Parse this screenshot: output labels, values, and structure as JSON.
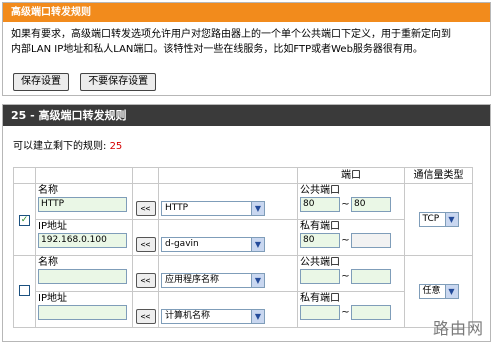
{
  "advanced_forwarding": {
    "title": "高级端口转发规则",
    "description_line1": "如果有要求，高级端口转发选项允许用户对您路由器上的一个单个公共端口下定义，用于重新定向到",
    "description_line2": "内部LAN IP地址和私人LAN端口。该特性对一些在线服务，比如FTP或者Web服务器很有用。",
    "save_label": "保存设置",
    "dont_save_label": "不要保存设置"
  },
  "rules_section": {
    "title": "25 - 高级端口转发规则",
    "remaining_label": "可以建立剩下的规则: ",
    "remaining_count": "25",
    "header_port": "端口",
    "header_traffic_type": "通信量类型"
  },
  "rules": [
    {
      "checked": true,
      "check_mark": "✓",
      "name_label": "名称",
      "name_value": "HTTP",
      "arrow_label": "<<",
      "app_select": "HTTP",
      "ip_label": "IP地址",
      "ip_value": "192.168.0.100",
      "computer_select": "d-gavin",
      "public_port_label": "公共端口",
      "public_port_start": "80",
      "public_port_end": "80",
      "tilde": "~",
      "private_port_label": "私有端口",
      "private_port_start": "80",
      "private_port_end": "",
      "traffic_type": "TCP"
    },
    {
      "checked": false,
      "check_mark": "",
      "name_label": "名称",
      "name_value": "",
      "arrow_label": "<<",
      "app_select": "应用程序名称",
      "ip_label": "IP地址",
      "ip_value": "",
      "computer_select": "计算机名称",
      "public_port_label": "公共端口",
      "public_port_start": "",
      "public_port_end": "",
      "tilde": "~",
      "private_port_label": "私有端口",
      "private_port_start": "",
      "private_port_end": "",
      "traffic_type": "任意"
    }
  ],
  "watermark": "路由网",
  "icons": {
    "select_arrow": "chevron-down-icon",
    "checkbox": "checkbox-icon"
  }
}
